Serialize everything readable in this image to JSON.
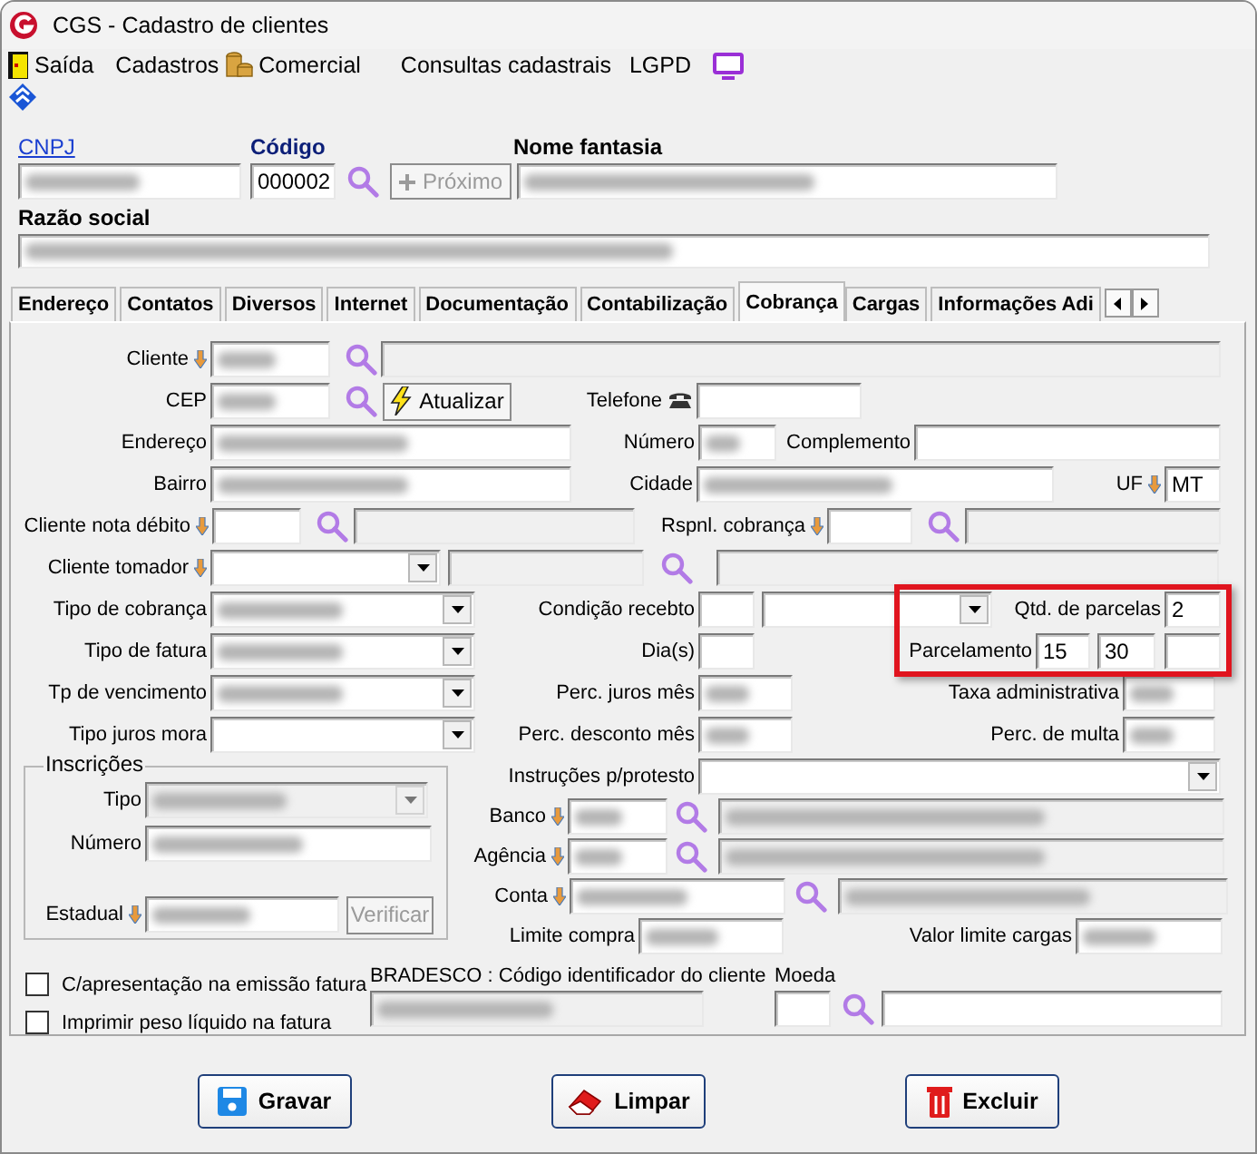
{
  "window": {
    "title": "CGS - Cadastro de clientes"
  },
  "menu": [
    {
      "label": "Saída"
    },
    {
      "label": "Cadastros"
    },
    {
      "label": "Comercial"
    },
    {
      "label": "Consultas cadastrais"
    },
    {
      "label": "LGPD"
    }
  ],
  "header": {
    "cnpj": {
      "label": "CNPJ",
      "redacted": true
    },
    "codigo": {
      "label": "Código",
      "value": "000002"
    },
    "proximo": {
      "label": "Próximo",
      "disabled": true
    },
    "nome_fantasia": {
      "label": "Nome fantasia",
      "redacted": true
    },
    "razao_social": {
      "label": "Razão social",
      "redacted": true
    }
  },
  "tabs": [
    {
      "label": "Endereço",
      "selected": false
    },
    {
      "label": "Contatos",
      "selected": false
    },
    {
      "label": "Diversos",
      "selected": false
    },
    {
      "label": "Internet",
      "selected": false
    },
    {
      "label": "Documentação",
      "selected": false
    },
    {
      "label": "Contabilização",
      "selected": false
    },
    {
      "label": "Cobrança",
      "selected": true
    },
    {
      "label": "Cargas",
      "selected": false
    },
    {
      "label": "Informações Adi",
      "selected": false
    }
  ],
  "form": {
    "cliente": {
      "label": "Cliente",
      "redacted": true
    },
    "cep": {
      "label": "CEP",
      "redacted": true
    },
    "atualizar": {
      "label": "Atualizar"
    },
    "telefone": {
      "label": "Telefone"
    },
    "endereco": {
      "label": "Endereço",
      "redacted": true
    },
    "numero": {
      "label": "Número",
      "redacted": true
    },
    "complemento": {
      "label": "Complemento"
    },
    "bairro": {
      "label": "Bairro",
      "redacted": true
    },
    "cidade": {
      "label": "Cidade",
      "redacted": true
    },
    "uf": {
      "label": "UF",
      "value": "MT"
    },
    "cliente_nota_debito": {
      "label": "Cliente nota débito"
    },
    "rspnl_cobranca": {
      "label": "Rspnl. cobrança"
    },
    "cliente_tomador": {
      "label": "Cliente tomador"
    },
    "tipo_cobranca": {
      "label": "Tipo de cobrança",
      "redacted": true
    },
    "condicao_recebto": {
      "label": "Condição recebto"
    },
    "tipo_fatura": {
      "label": "Tipo de fatura",
      "redacted": true
    },
    "dias": {
      "label": "Dia(s)"
    },
    "tp_vencimento": {
      "label": "Tp de vencimento",
      "redacted": true
    },
    "perc_juros_mes": {
      "label": "Perc. juros mês",
      "redacted": true
    },
    "taxa_administrativa": {
      "label": "Taxa administrativa",
      "redacted": true
    },
    "tipo_juros_mora": {
      "label": "Tipo juros mora"
    },
    "perc_desconto_mes": {
      "label": "Perc. desconto mês",
      "redacted": true
    },
    "perc_multa": {
      "label": "Perc. de multa",
      "redacted": true
    },
    "parcelas": {
      "highlighted": true,
      "qtd": {
        "label": "Qtd. de parcelas",
        "value": "2"
      },
      "parcelamento": {
        "label": "Parcelamento",
        "values": [
          "15",
          "30"
        ]
      }
    },
    "instrucoes_protesto": {
      "label": "Instruções p/protesto"
    },
    "inscricoes": {
      "title": "Inscrições",
      "tipo": {
        "label": "Tipo",
        "redacted": true,
        "disabled": true
      },
      "numero": {
        "label": "Número",
        "redacted": true
      },
      "estadual": {
        "label": "Estadual",
        "redacted": true
      },
      "verificar": {
        "label": "Verificar",
        "disabled": true
      }
    },
    "banco": {
      "label": "Banco",
      "redacted": true,
      "desc_redacted": true
    },
    "agencia": {
      "label": "Agência",
      "redacted": true,
      "desc_redacted": true
    },
    "conta": {
      "label": "Conta",
      "redacted": true,
      "desc_redacted": true
    },
    "limite_compra": {
      "label": "Limite compra",
      "redacted": true
    },
    "valor_limite_cargas": {
      "label": "Valor limite cargas",
      "redacted": true
    },
    "bradesco": {
      "label": "BRADESCO : Código identificador do cliente",
      "redacted": true
    },
    "moeda": {
      "label": "Moeda"
    }
  },
  "checkboxes": [
    {
      "label": "C/apresentação na emissão fatura",
      "checked": false
    },
    {
      "label": "Imprimir peso líquido na fatura",
      "checked": false
    }
  ],
  "buttons": [
    {
      "label": "Gravar"
    },
    {
      "label": "Limpar"
    },
    {
      "label": "Excluir"
    }
  ]
}
